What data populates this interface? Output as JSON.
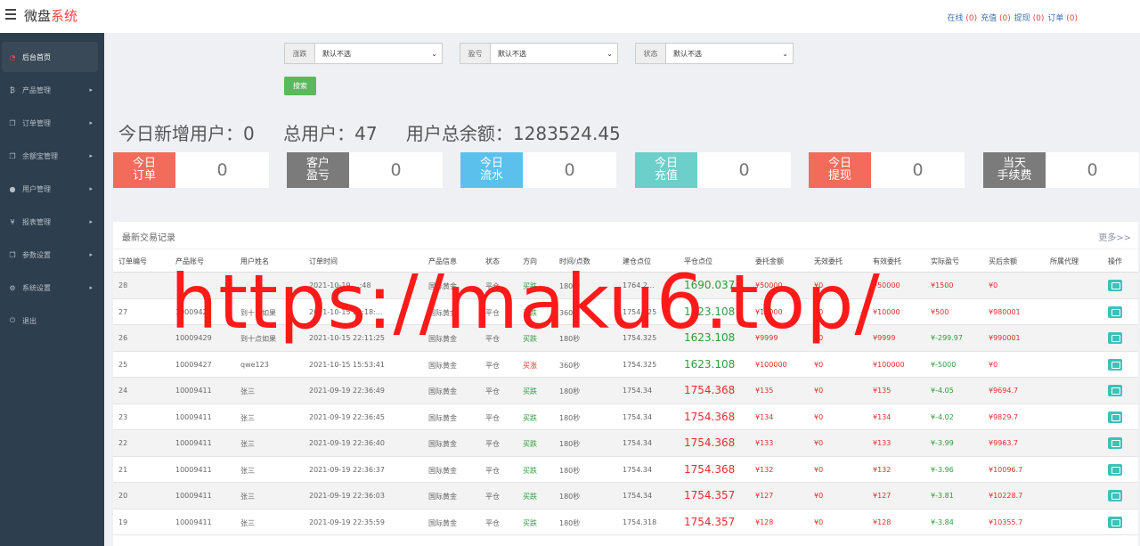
{
  "brand": {
    "prefix": "微盘",
    "accent": "系统"
  },
  "topnav": [
    {
      "label": "在线",
      "count": "(0)"
    },
    {
      "label": "充值",
      "count": "(0)"
    },
    {
      "label": "提现",
      "count": "(0)"
    },
    {
      "label": "订单",
      "count": "(0)"
    }
  ],
  "sidebar": {
    "items": [
      {
        "label": "后台首页",
        "icon": "dashboard-icon"
      },
      {
        "label": "产品管理",
        "icon": "bitcoin-icon"
      },
      {
        "label": "订单管理",
        "icon": "copy-icon"
      },
      {
        "label": "余额宝管理",
        "icon": "copy-icon"
      },
      {
        "label": "用户管理",
        "icon": "user-icon"
      },
      {
        "label": "报表管理",
        "icon": "yen-icon"
      },
      {
        "label": "参数设置",
        "icon": "copy-icon"
      },
      {
        "label": "系统设置",
        "icon": "cogs-icon"
      },
      {
        "label": "退出",
        "icon": "power-icon"
      }
    ]
  },
  "filters": [
    {
      "label": "涨跌",
      "value": "默认不选"
    },
    {
      "label": "盈亏",
      "value": "默认不选"
    },
    {
      "label": "状态",
      "value": "默认不选"
    }
  ],
  "search_label": "搜索",
  "stats": {
    "new_users": "今日新增用户：0",
    "total_users": "总用户：47",
    "total_balance": "用户总余额：1283524.45"
  },
  "cards": [
    {
      "l1": "今日",
      "l2": "订单",
      "value": "0",
      "color": "#f26b5b"
    },
    {
      "l1": "客户",
      "l2": "盈亏",
      "value": "0",
      "color": "#7b7b7b"
    },
    {
      "l1": "今日",
      "l2": "流水",
      "value": "0",
      "color": "#5bc0eb"
    },
    {
      "l1": "今日",
      "l2": "充值",
      "value": "0",
      "color": "#6ccfc9"
    },
    {
      "l1": "今日",
      "l2": "提现",
      "value": "0",
      "color": "#f26b5b"
    },
    {
      "l1": "当天",
      "l2": "手续费",
      "value": "0",
      "color": "#7b7b7b"
    }
  ],
  "panel": {
    "title": "最新交易记录",
    "more": "更多>>"
  },
  "columns": [
    "订单编号",
    "产品账号",
    "用户姓名",
    "订单时间",
    "产品信息",
    "状态",
    "方向",
    "时间/点数",
    "建仓点位",
    "平仓点位",
    "委托金额",
    "无效委托",
    "有效委托",
    "实际盈亏",
    "买后余额",
    "所属代理",
    "操作"
  ],
  "rows": [
    {
      "id": "28",
      "acct": "",
      "name": "",
      "time": "2021-10-19 ...:48",
      "product": "国际黄金",
      "status": "平仓",
      "dir": "买跌",
      "dur": "180秒",
      "open": "1764.2...",
      "close": "1690.037",
      "amount": "¥50000",
      "invalid": "¥0",
      "valid": "¥50000",
      "pnl": "¥1500",
      "bal": "¥0"
    },
    {
      "id": "27",
      "acct": "1000942",
      "name": "到十点如果",
      "time": "2021-10-15 22:18:...",
      "product": "国际黄金",
      "status": "平仓",
      "dir": "买跌",
      "dur": "360秒",
      "open": "1754.325",
      "close": "1623.108",
      "amount": "¥10000",
      "invalid": "¥0",
      "valid": "¥10000",
      "pnl": "¥500",
      "bal": "¥980001"
    },
    {
      "id": "26",
      "acct": "10009429",
      "name": "到十点如果",
      "time": "2021-10-15 22:11:25",
      "product": "国际黄金",
      "status": "平仓",
      "dir": "买跌",
      "dur": "180秒",
      "open": "1754.325",
      "close": "1623.108",
      "amount": "¥9999",
      "invalid": "¥0",
      "valid": "¥9999",
      "pnl": "¥-299.97",
      "bal": "¥990001"
    },
    {
      "id": "25",
      "acct": "10009427",
      "name": "qwe123",
      "time": "2021-10-15 15:53:41",
      "product": "国际黄金",
      "status": "平仓",
      "dir": "买涨",
      "dur": "360秒",
      "open": "1754.325",
      "close": "1623.108",
      "amount": "¥100000",
      "invalid": "¥0",
      "valid": "¥100000",
      "pnl": "¥-5000",
      "bal": "¥0"
    },
    {
      "id": "24",
      "acct": "10009411",
      "name": "张三",
      "time": "2021-09-19 22:36:49",
      "product": "国际黄金",
      "status": "平仓",
      "dir": "买跌",
      "dur": "180秒",
      "open": "1754.34",
      "close": "1754.368",
      "amount": "¥135",
      "invalid": "¥0",
      "valid": "¥135",
      "pnl": "¥-4.05",
      "bal": "¥9694.7"
    },
    {
      "id": "23",
      "acct": "10009411",
      "name": "张三",
      "time": "2021-09-19 22:36:45",
      "product": "国际黄金",
      "status": "平仓",
      "dir": "买跌",
      "dur": "180秒",
      "open": "1754.34",
      "close": "1754.368",
      "amount": "¥134",
      "invalid": "¥0",
      "valid": "¥134",
      "pnl": "¥-4.02",
      "bal": "¥9829.7"
    },
    {
      "id": "22",
      "acct": "10009411",
      "name": "张三",
      "time": "2021-09-19 22:36:40",
      "product": "国际黄金",
      "status": "平仓",
      "dir": "买跌",
      "dur": "180秒",
      "open": "1754.34",
      "close": "1754.368",
      "amount": "¥133",
      "invalid": "¥0",
      "valid": "¥133",
      "pnl": "¥-3.99",
      "bal": "¥9963.7"
    },
    {
      "id": "21",
      "acct": "10009411",
      "name": "张三",
      "time": "2021-09-19 22:36:37",
      "product": "国际黄金",
      "status": "平仓",
      "dir": "买跌",
      "dur": "180秒",
      "open": "1754.34",
      "close": "1754.368",
      "amount": "¥132",
      "invalid": "¥0",
      "valid": "¥132",
      "pnl": "¥-3.96",
      "bal": "¥10096.7"
    },
    {
      "id": "20",
      "acct": "10009411",
      "name": "张三",
      "time": "2021-09-19 22:36:03",
      "product": "国际黄金",
      "status": "平仓",
      "dir": "买跌",
      "dur": "180秒",
      "open": "1754.34",
      "close": "1754.357",
      "amount": "¥127",
      "invalid": "¥0",
      "valid": "¥127",
      "pnl": "¥-3.81",
      "bal": "¥10228.7"
    },
    {
      "id": "19",
      "acct": "10009411",
      "name": "张三",
      "time": "2021-09-19 22:35:59",
      "product": "国际黄金",
      "status": "平仓",
      "dir": "买跌",
      "dur": "180秒",
      "open": "1754.318",
      "close": "1754.357",
      "amount": "¥128",
      "invalid": "¥0",
      "valid": "¥128",
      "pnl": "¥-3.84",
      "bal": "¥10355.7"
    }
  ],
  "watermark": "https://maku6.top/"
}
